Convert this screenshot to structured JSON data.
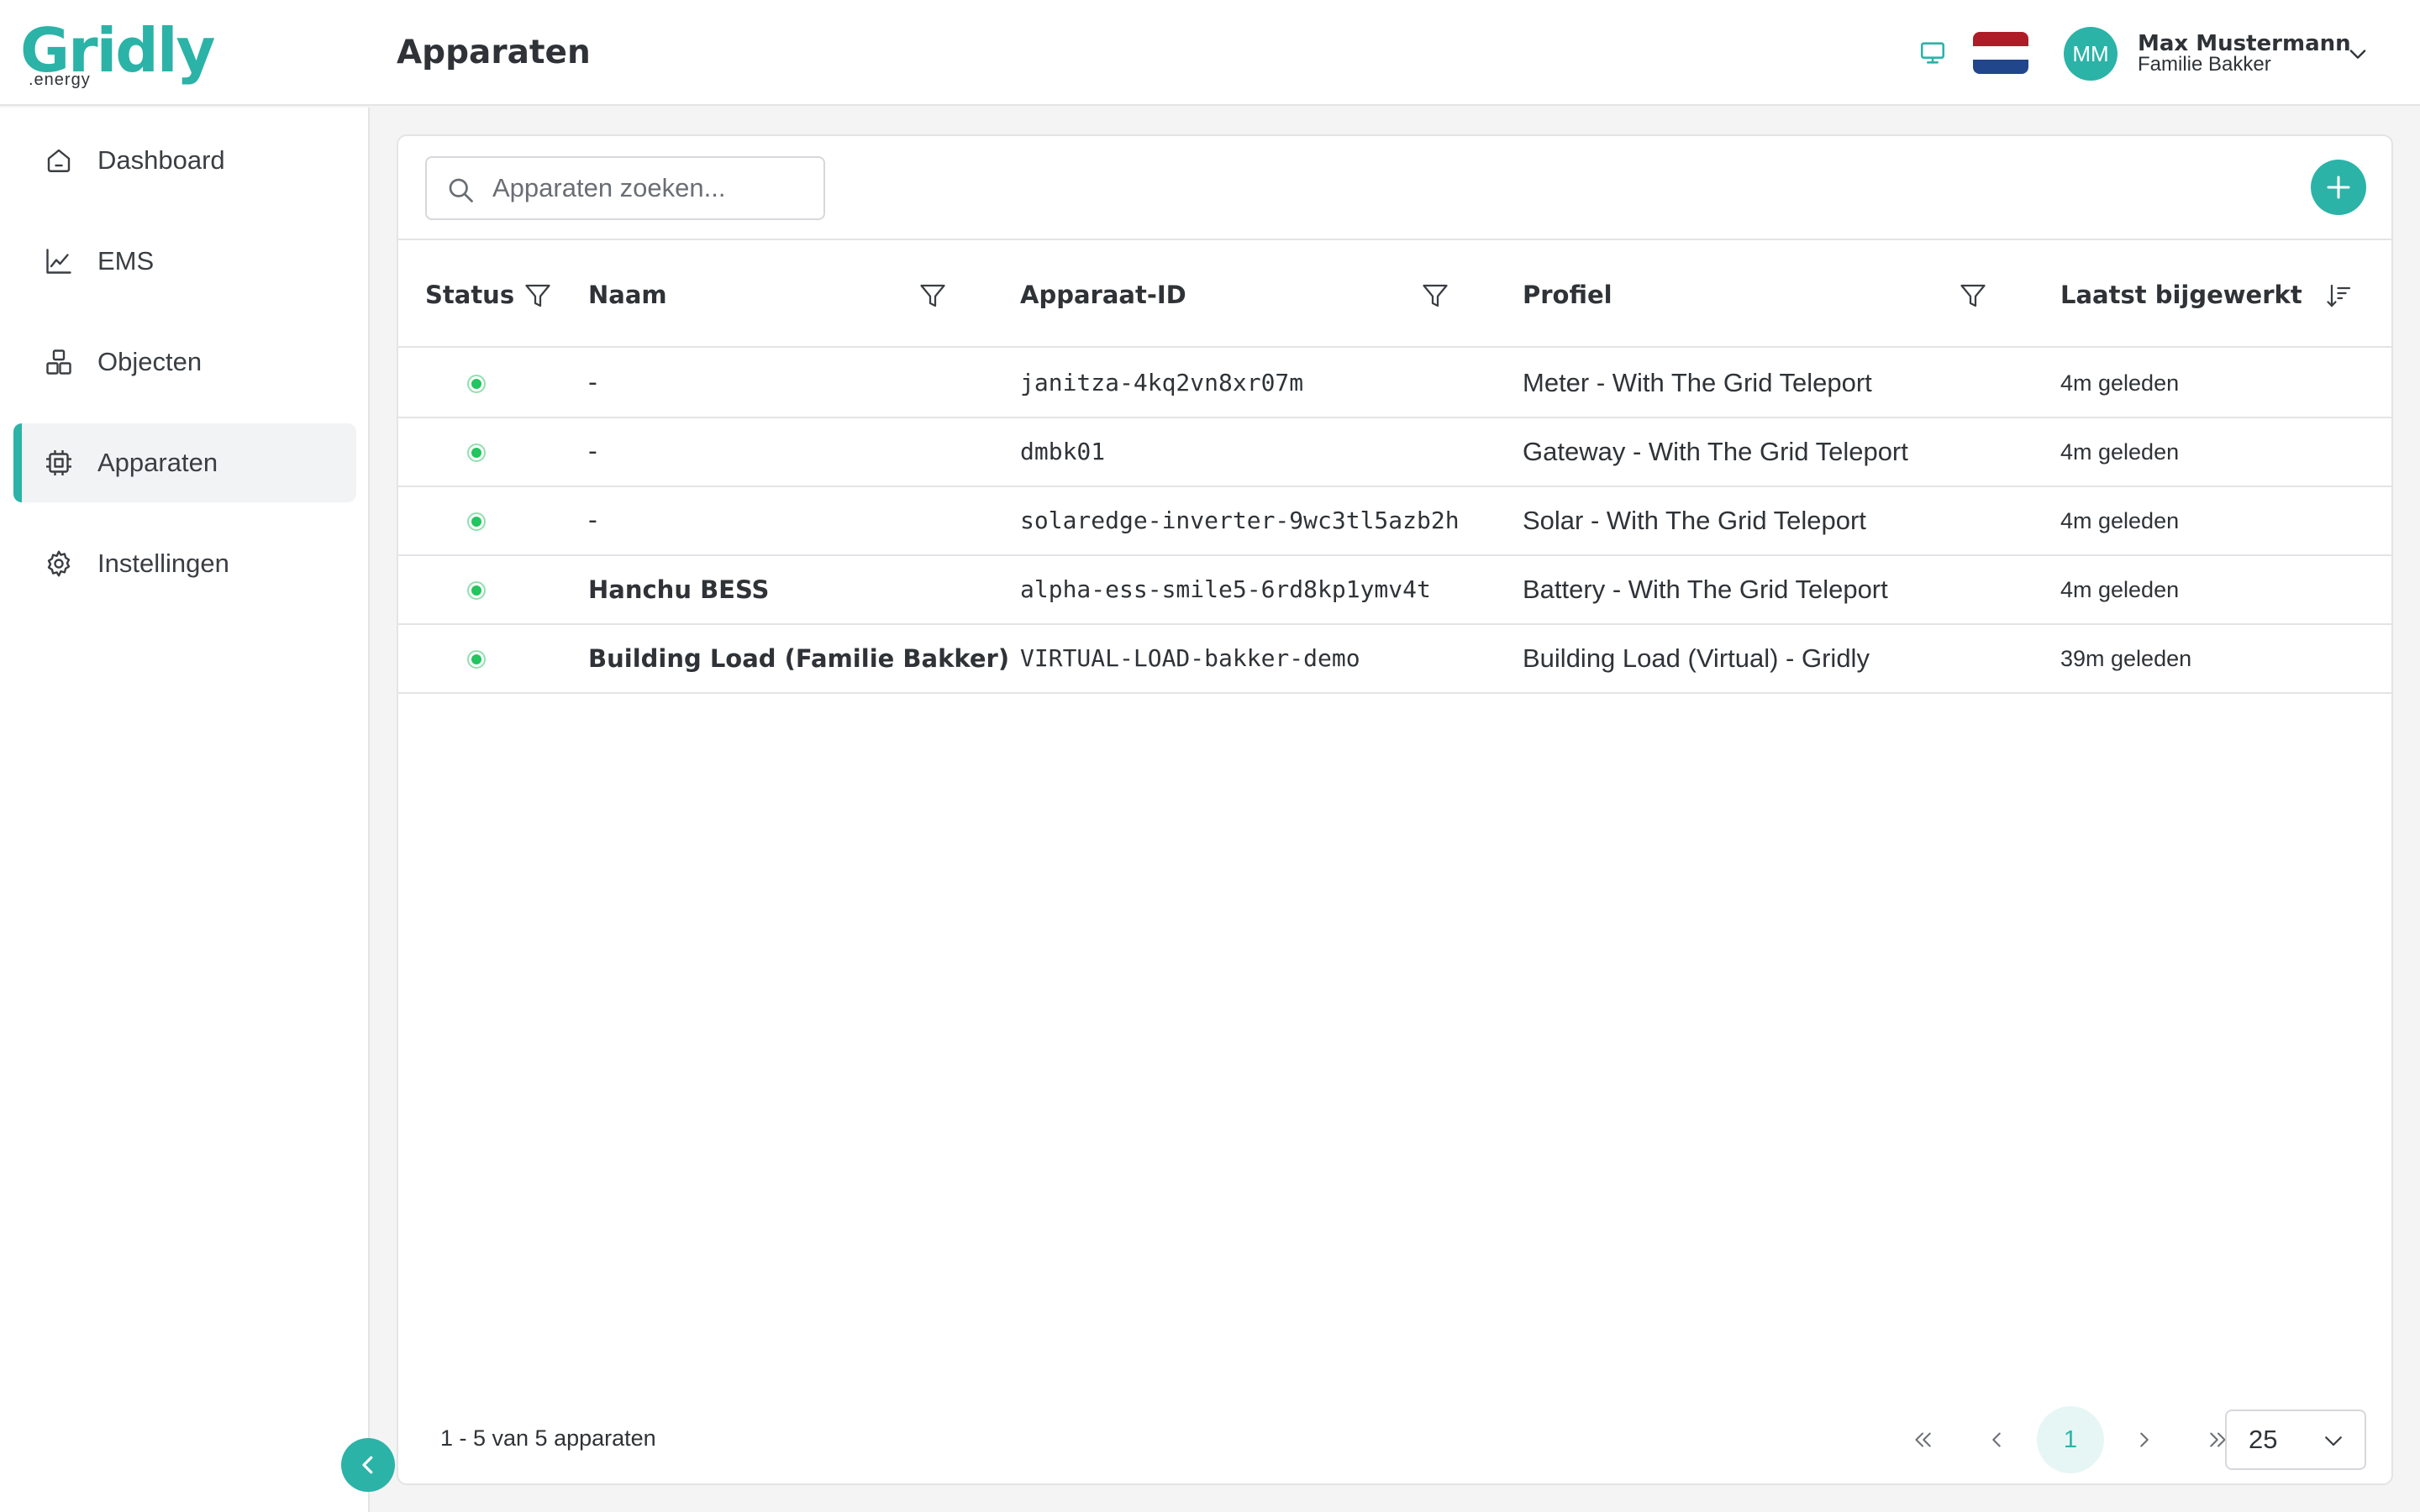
{
  "app": {
    "logo_word": "Gridly",
    "logo_sub": ".energy",
    "brand_color": "#2bb3a8"
  },
  "header": {
    "title": "Apparaten",
    "monitor_icon": "monitor-icon",
    "language_flag": "nl-flag",
    "user": {
      "initials": "MM",
      "name": "Max Mustermann",
      "organization": "Familie Bakker"
    }
  },
  "sidebar": {
    "items": [
      {
        "label": "Dashboard",
        "icon": "home-icon",
        "active": false
      },
      {
        "label": "EMS",
        "icon": "chart-line-icon",
        "active": false
      },
      {
        "label": "Objecten",
        "icon": "boxes-icon",
        "active": false
      },
      {
        "label": "Apparaten",
        "icon": "chip-icon",
        "active": true
      },
      {
        "label": "Instellingen",
        "icon": "gear-icon",
        "active": false
      }
    ]
  },
  "search": {
    "placeholder": "Apparaten zoeken...",
    "value": ""
  },
  "table": {
    "columns": [
      "Status",
      "Naam",
      "Apparaat-ID",
      "Profiel",
      "Laatst bijgewerkt"
    ],
    "rows": [
      {
        "status": "online",
        "name": "-",
        "device_id": "janitza-4kq2vn8xr07m",
        "profile": "Meter - With The Grid Teleport",
        "updated": "4m geleden"
      },
      {
        "status": "online",
        "name": "-",
        "device_id": "dmbk01",
        "profile": "Gateway - With The Grid Teleport",
        "updated": "4m geleden"
      },
      {
        "status": "online",
        "name": "-",
        "device_id": "solaredge-inverter-9wc3tl5azb2h",
        "profile": "Solar - With The Grid Teleport",
        "updated": "4m geleden"
      },
      {
        "status": "online",
        "name": "Hanchu BESS",
        "device_id": "alpha-ess-smile5-6rd8kp1ymv4t",
        "profile": "Battery - With The Grid Teleport",
        "updated": "4m geleden"
      },
      {
        "status": "online",
        "name": "Building Load (Familie Bakker)",
        "device_id": "VIRTUAL-LOAD-bakker-demo",
        "profile": "Building Load (Virtual) - Gridly",
        "updated": "39m geleden"
      }
    ]
  },
  "footer": {
    "count_text": "1 - 5 van 5 apparaten",
    "current_page": "1",
    "page_size": "25"
  },
  "colors": {
    "accent": "#2bb3a8",
    "status_online": "#22c55e",
    "flag": [
      "#ae1c28",
      "#ffffff",
      "#21468b"
    ]
  }
}
